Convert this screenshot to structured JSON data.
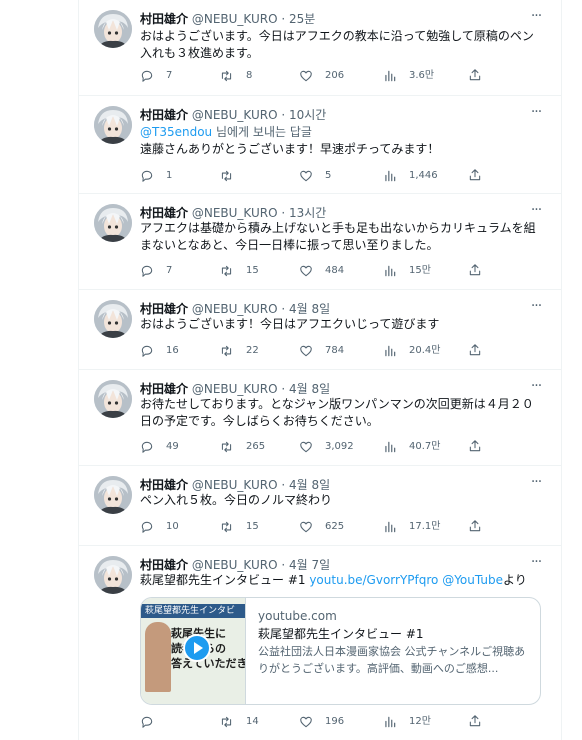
{
  "colors": {
    "accent": "#1d9bf0",
    "muted": "#536471",
    "text": "#0f1419",
    "border": "#eff3f4"
  },
  "user": {
    "name": "村田雄介",
    "handle": "@NEBU_KURO"
  },
  "tweets": [
    {
      "time": "25분",
      "text": "おはようございます。今日はアフエクの教本に沿って勉強して原稿のペン入れも３枚進めます。",
      "replies": "7",
      "retweets": "8",
      "likes": "206",
      "views": "3.6만"
    },
    {
      "time": "10시간",
      "reply_to_handle": "@T35endou",
      "reply_to_suffix": " 님에게 보내는 답글",
      "text": "遠藤さんありがとうございます！早速ポチってみます！",
      "replies": "1",
      "retweets": "",
      "likes": "5",
      "views": "1,446"
    },
    {
      "time": "13시간",
      "text": "アフエクは基礎から積み上げないと手も足も出ないからカリキュラムを組まないとなあと、今日一日棒に振って思い至りました。",
      "replies": "7",
      "retweets": "15",
      "likes": "484",
      "views": "15만"
    },
    {
      "time": "4월 8일",
      "text": "おはようございます！今日はアフエクいじって遊びます",
      "replies": "16",
      "retweets": "22",
      "likes": "784",
      "views": "20.4만"
    },
    {
      "time": "4월 8일",
      "text": "お待たせしております。となジャン版ワンパンマンの次回更新は４月２０日の予定です。今しばらくお待ちください。",
      "replies": "49",
      "retweets": "265",
      "likes": "3,092",
      "views": "40.7만"
    },
    {
      "time": "4월 8일",
      "text": "ペン入れ５枚。今日のノルマ終わり",
      "replies": "10",
      "retweets": "15",
      "likes": "625",
      "views": "17.1만"
    },
    {
      "time": "4월 7일",
      "text_prefix": "萩尾望都先生インタビュー #1 ",
      "link1": "youtu.be/GvorrYPfqro",
      "link2": " @YouTube",
      "text_suffix": "より",
      "replies": "",
      "retweets": "14",
      "likes": "196",
      "views": "12만",
      "card": {
        "domain": "youtube.com",
        "title": "萩尾望都先生インタビュー #1",
        "desc": "公益社団法人日本漫画家協会 公式チャンネルご視聴ありがとうございます。高評価、動画へのご感想...",
        "thumb_bar": "萩尾望都先生インタビ",
        "thumb_text1": "萩尾先生に",
        "thumb_text2": "読者からの",
        "thumb_text3": "答えていただき"
      }
    }
  ]
}
